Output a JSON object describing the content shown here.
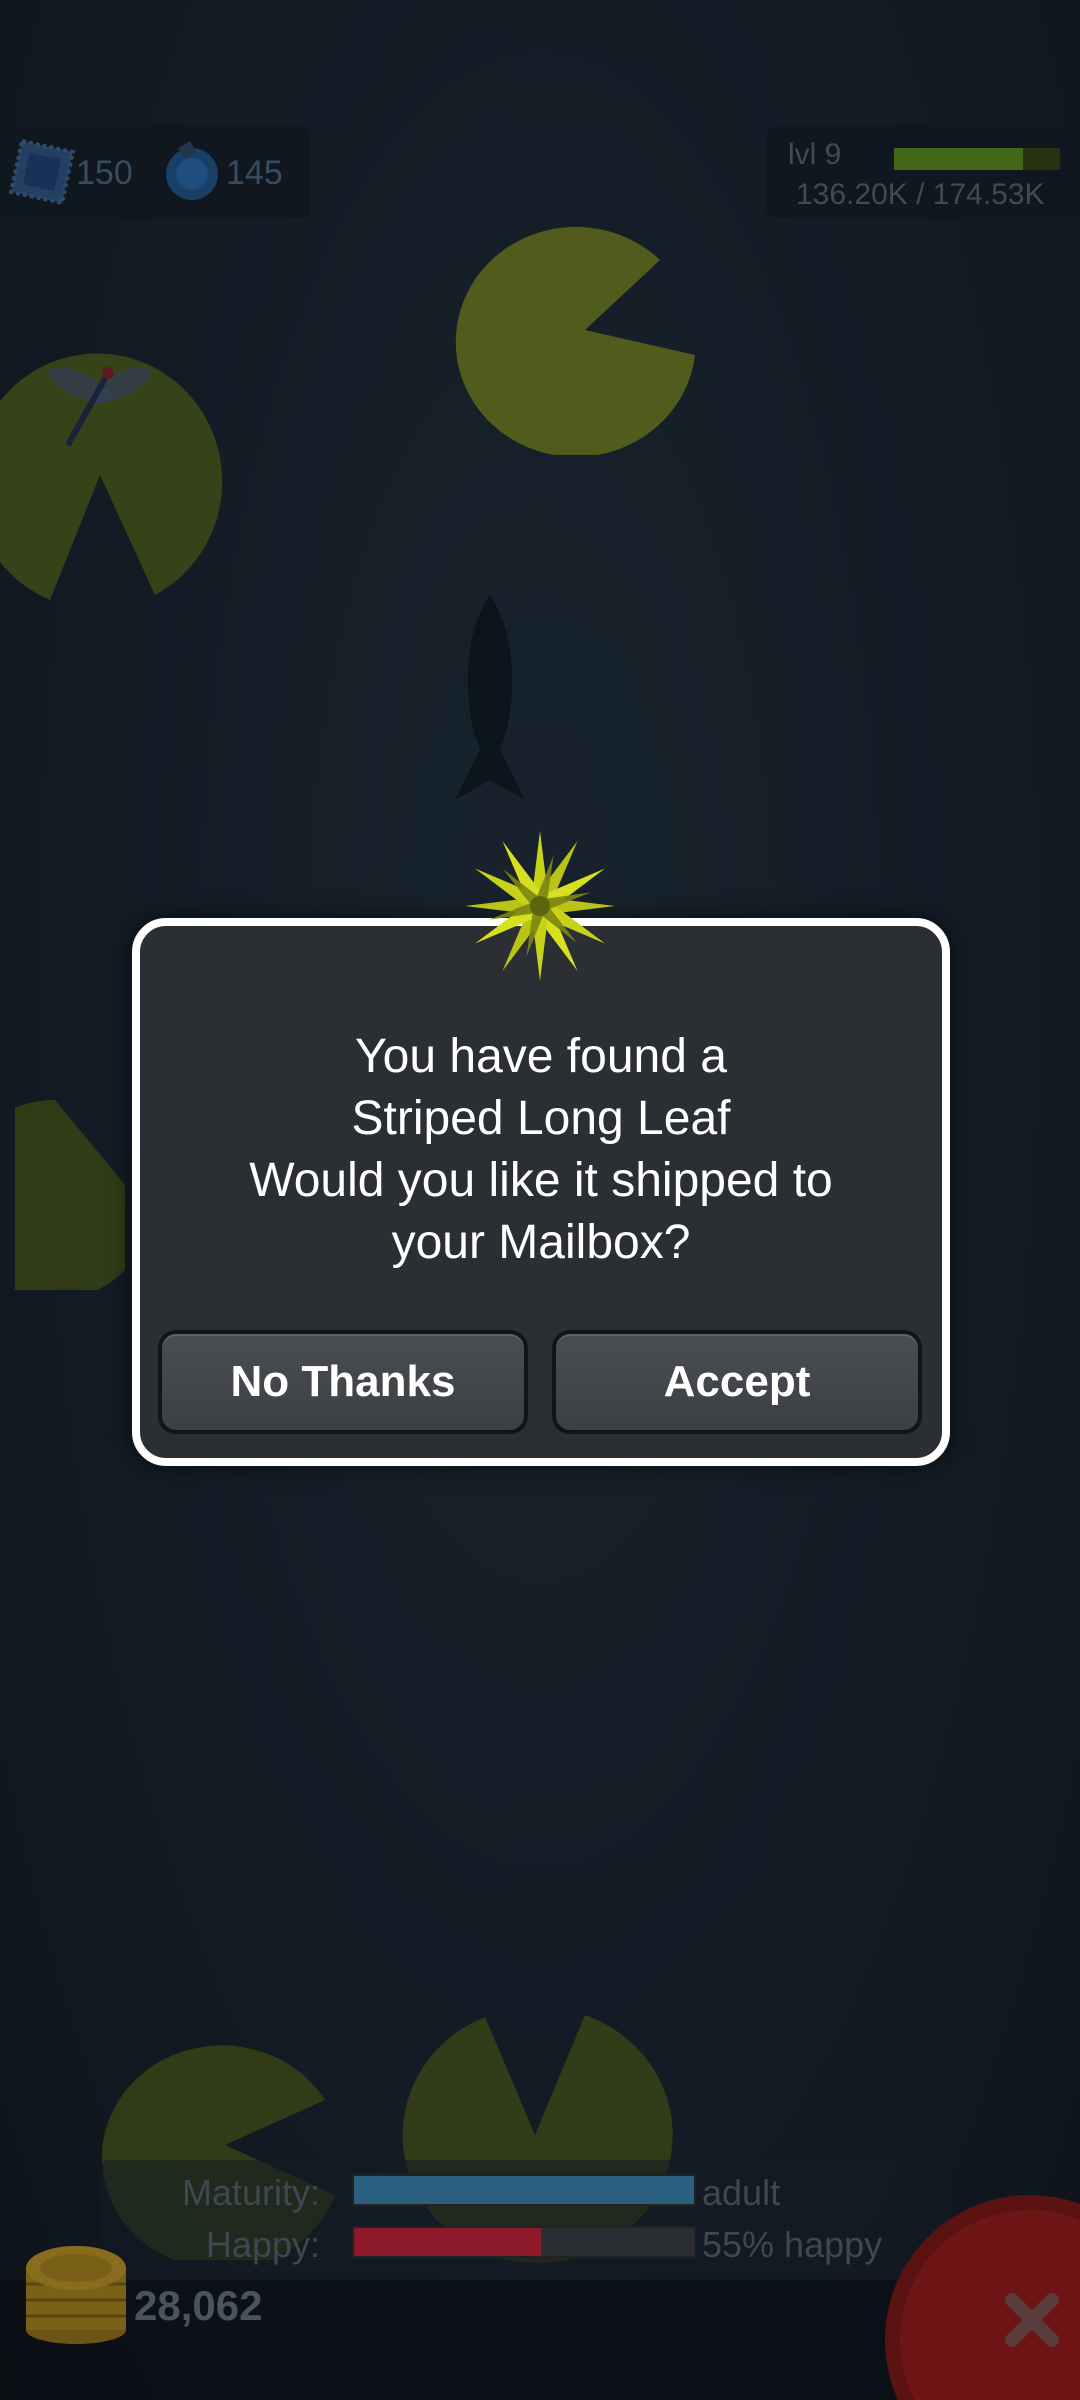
{
  "hud": {
    "stamps": "150",
    "orbs": "145",
    "level_label": "lvl 9",
    "xp_text": "136.20K / 174.53K",
    "xp_progress": 0.78
  },
  "dialog": {
    "lines": [
      "You have found a",
      "Striped Long Leaf",
      "Would you like it shipped to",
      "your Mailbox?"
    ],
    "no_label": "No Thanks",
    "accept_label": "Accept"
  },
  "stats": {
    "maturity_label": "Maturity:",
    "maturity_value": "adult",
    "maturity_progress": 1.0,
    "happy_label": "Happy:",
    "happy_value": "55% happy",
    "happy_progress": 0.55
  },
  "coins": "28,062",
  "colors": {
    "accent_green": "#5a8a22",
    "maturity_blue": "#2e6a8e",
    "happy_red": "#a3172c",
    "close_red": "#9a1a1a"
  }
}
